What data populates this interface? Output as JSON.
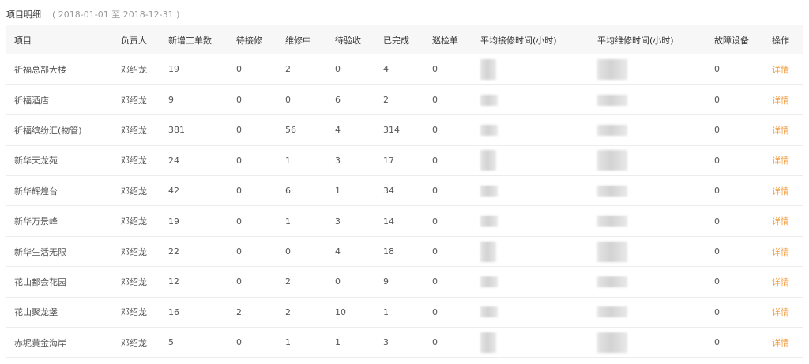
{
  "header": {
    "title": "项目明细",
    "range": "( 2018-01-01 至 2018-12-31 )"
  },
  "columns": [
    "项目",
    "负责人",
    "新增工单数",
    "待接修",
    "维修中",
    "待验收",
    "已完成",
    "巡检单",
    "平均接修时间(小时)",
    "平均维修时间(小时)",
    "故障设备",
    "操作"
  ],
  "rows": [
    {
      "project": "祈福总部大楼",
      "owner": "邓绍龙",
      "new": "19",
      "wait_repair": "0",
      "repairing": "2",
      "wait_check": "0",
      "done": "4",
      "patrol": "0",
      "fault": "0",
      "action": "详情"
    },
    {
      "project": "祈福酒店",
      "owner": "邓绍龙",
      "new": "9",
      "wait_repair": "0",
      "repairing": "0",
      "wait_check": "6",
      "done": "2",
      "patrol": "0",
      "fault": "0",
      "action": "详情"
    },
    {
      "project": "祈福缤纷汇(物管)",
      "owner": "邓绍龙",
      "new": "381",
      "wait_repair": "0",
      "repairing": "56",
      "wait_check": "4",
      "done": "314",
      "patrol": "0",
      "fault": "0",
      "action": "详情"
    },
    {
      "project": "新华天龙苑",
      "owner": "邓绍龙",
      "new": "24",
      "wait_repair": "0",
      "repairing": "1",
      "wait_check": "3",
      "done": "17",
      "patrol": "0",
      "fault": "0",
      "action": "详情"
    },
    {
      "project": "新华辉煌台",
      "owner": "邓绍龙",
      "new": "42",
      "wait_repair": "0",
      "repairing": "6",
      "wait_check": "1",
      "done": "34",
      "patrol": "0",
      "fault": "0",
      "action": "详情"
    },
    {
      "project": "新华万景峰",
      "owner": "邓绍龙",
      "new": "19",
      "wait_repair": "0",
      "repairing": "1",
      "wait_check": "3",
      "done": "14",
      "patrol": "0",
      "fault": "0",
      "action": "详情"
    },
    {
      "project": "新华生活无限",
      "owner": "邓绍龙",
      "new": "22",
      "wait_repair": "0",
      "repairing": "0",
      "wait_check": "4",
      "done": "18",
      "patrol": "0",
      "fault": "0",
      "action": "详情"
    },
    {
      "project": "花山都会花园",
      "owner": "邓绍龙",
      "new": "12",
      "wait_repair": "0",
      "repairing": "2",
      "wait_check": "0",
      "done": "9",
      "patrol": "0",
      "fault": "0",
      "action": "详情"
    },
    {
      "project": "花山聚龙堡",
      "owner": "邓绍龙",
      "new": "16",
      "wait_repair": "2",
      "repairing": "2",
      "wait_check": "10",
      "done": "1",
      "patrol": "0",
      "fault": "0",
      "action": "详情"
    },
    {
      "project": "赤坭黄金海岸",
      "owner": "邓绍龙",
      "new": "5",
      "wait_repair": "0",
      "repairing": "1",
      "wait_check": "1",
      "done": "3",
      "patrol": "0",
      "fault": "0",
      "action": "详情"
    }
  ],
  "colors": {
    "action": "#f39c3d",
    "header_bg": "#f7f7f7",
    "row_border": "#ececec"
  }
}
